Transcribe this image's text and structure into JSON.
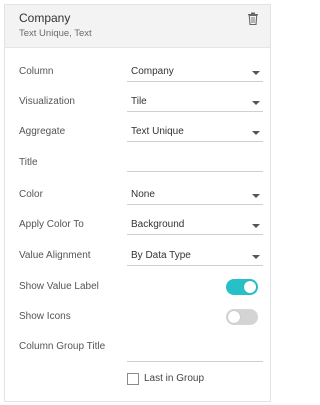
{
  "header": {
    "title": "Company",
    "subtitle": "Text Unique, Text"
  },
  "fields": {
    "column": {
      "label": "Column",
      "value": "Company"
    },
    "visualization": {
      "label": "Visualization",
      "value": "Tile"
    },
    "aggregate": {
      "label": "Aggregate",
      "value": "Text Unique"
    },
    "title": {
      "label": "Title",
      "value": ""
    },
    "color": {
      "label": "Color",
      "value": "None"
    },
    "apply_color_to": {
      "label": "Apply Color To",
      "value": "Background"
    },
    "value_alignment": {
      "label": "Value Alignment",
      "value": "By Data Type"
    },
    "show_value_label": {
      "label": "Show Value Label",
      "on": true
    },
    "show_icons": {
      "label": "Show Icons",
      "on": false
    },
    "column_group_title": {
      "label": "Column Group Title",
      "value": ""
    },
    "last_in_group": {
      "label": "Last in Group",
      "checked": false
    }
  },
  "colors": {
    "toggle_on": "#27c0c8",
    "toggle_off": "#d4d4d4",
    "header_bg": "#f3f3f3"
  },
  "icons": {
    "delete": "trash-icon",
    "dropdown": "chevron-down-icon"
  }
}
